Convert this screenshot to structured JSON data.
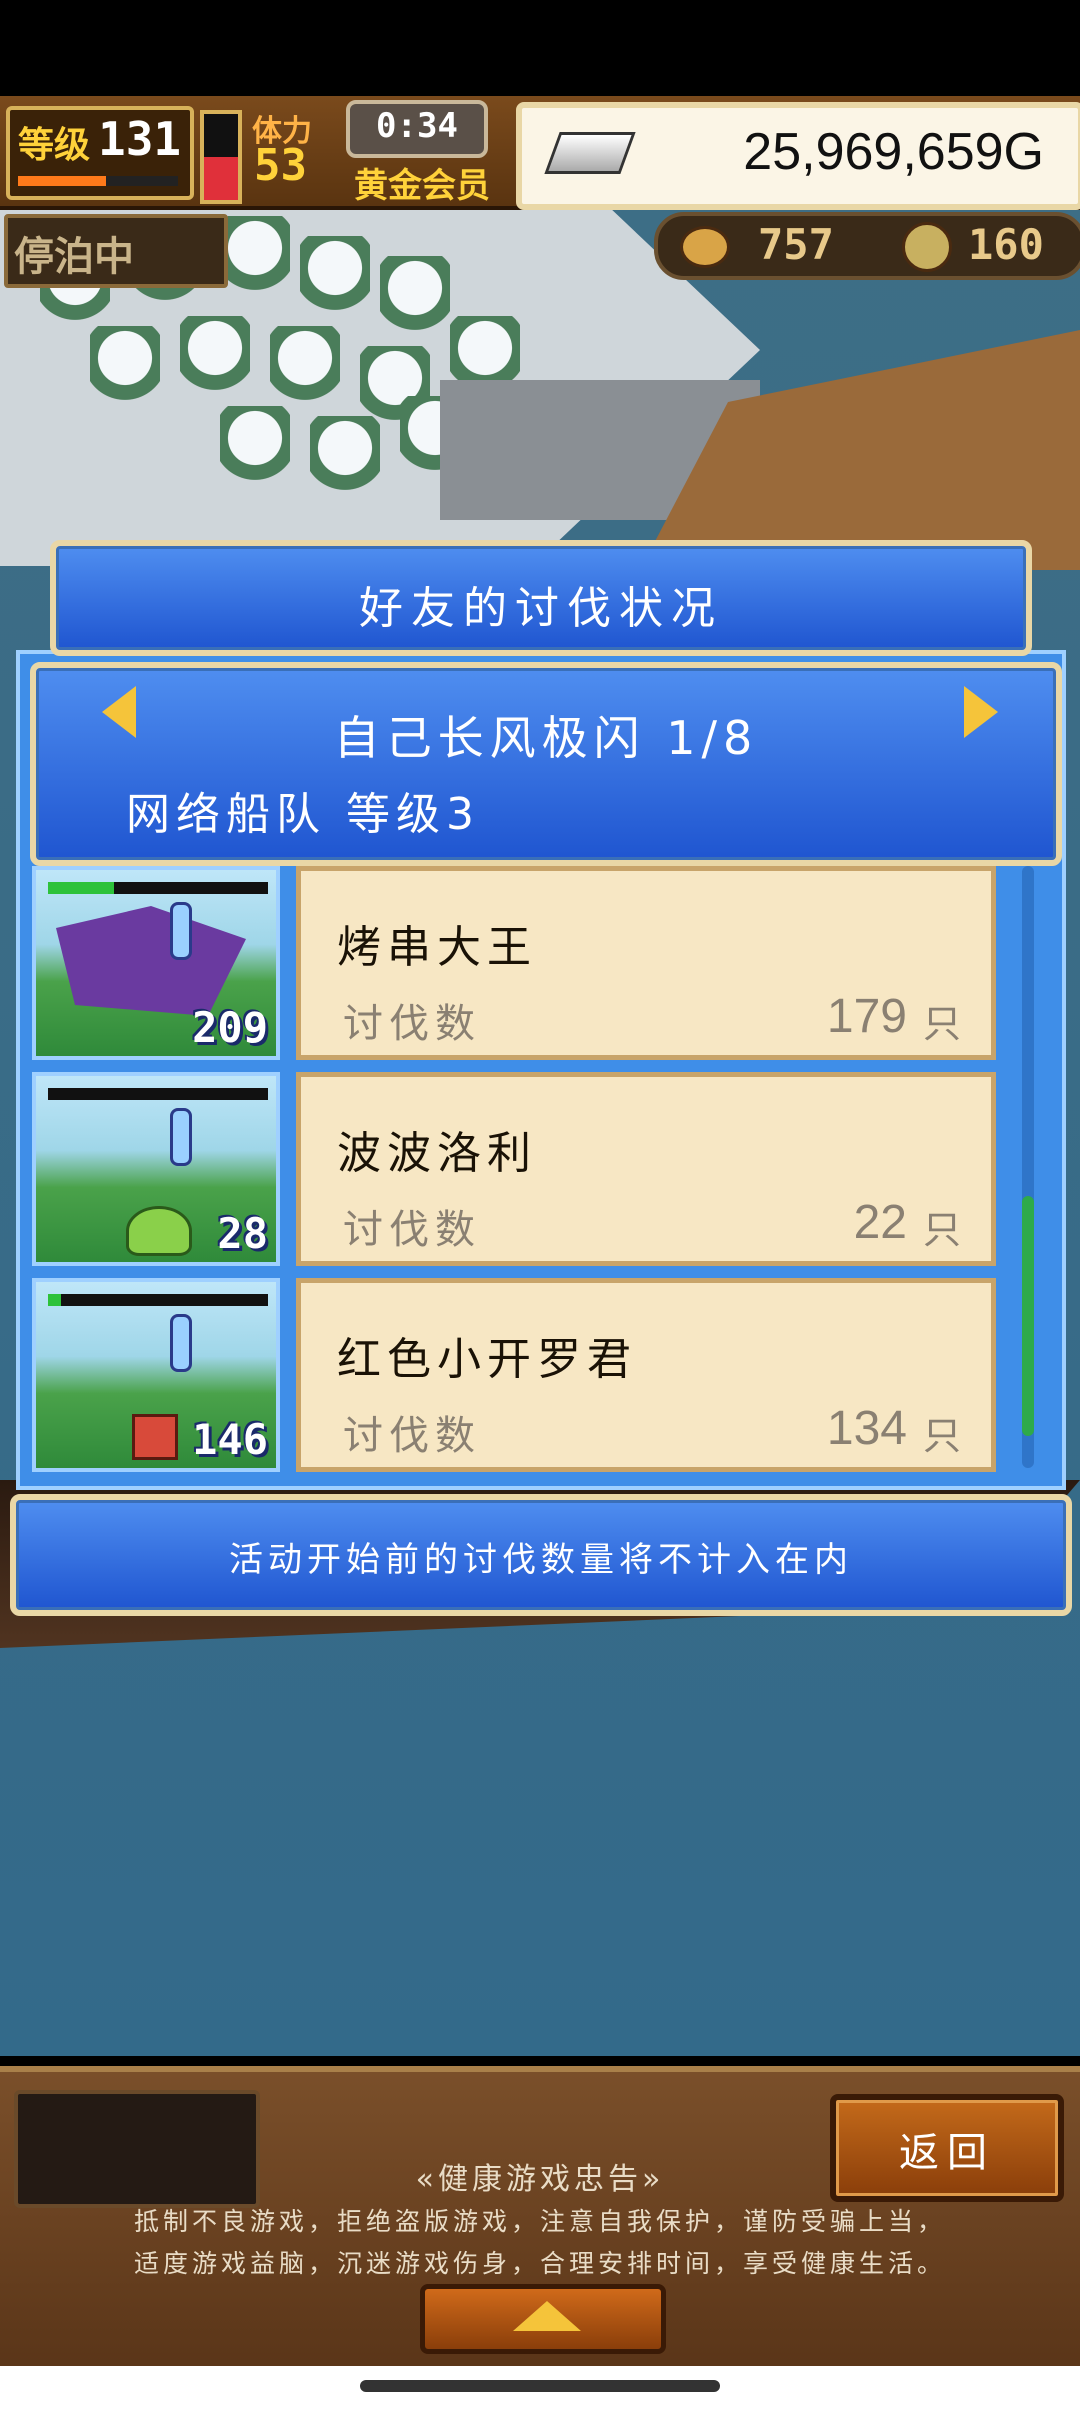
{
  "status": {
    "level_label": "等级",
    "level": "131",
    "stamina_label": "体力",
    "stamina": "53",
    "timer": "0:34",
    "membership": "黄金会员",
    "gold": "25,969,659G",
    "docked": "停泊中",
    "counter_1": "757",
    "counter_2": "160",
    "exp_fraction": 0.55,
    "hp_fraction": 0.5
  },
  "dialog": {
    "title": "好友的讨伐状况",
    "fleet_name": "自己长风极闪 1/8",
    "fleet_level": "网络船队 等级3",
    "kill_label": "讨伐数",
    "unit": "只",
    "entries": [
      {
        "name": "烤串大王",
        "count": "179",
        "monster_level": "209",
        "hp_fraction": 0.3,
        "color": "#6a3aa0"
      },
      {
        "name": "波波洛利",
        "count": "22",
        "monster_level": "28",
        "hp_fraction": 0.0,
        "color": "#8ad04a"
      },
      {
        "name": "红色小开罗君",
        "count": "134",
        "monster_level": "146",
        "hp_fraction": 0.06,
        "color": "#d84a3a"
      }
    ],
    "notice": "活动开始前的讨伐数量将不计入在内"
  },
  "bottom": {
    "back": "返回",
    "advisory_title": "«健康游戏忠告»",
    "advisory_line1": "抵制不良游戏，拒绝盗版游戏，注意自我保护，谨防受骗上当，",
    "advisory_line2": "适度游戏益脑，沉迷游戏伤身，合理安排时间，享受健康生活。"
  },
  "icons": [
    "silver-bar-icon",
    "anchor-icon",
    "meat-icon",
    "coin-icon",
    "left-arrow-icon",
    "right-arrow-icon",
    "up-arrow-icon"
  ]
}
